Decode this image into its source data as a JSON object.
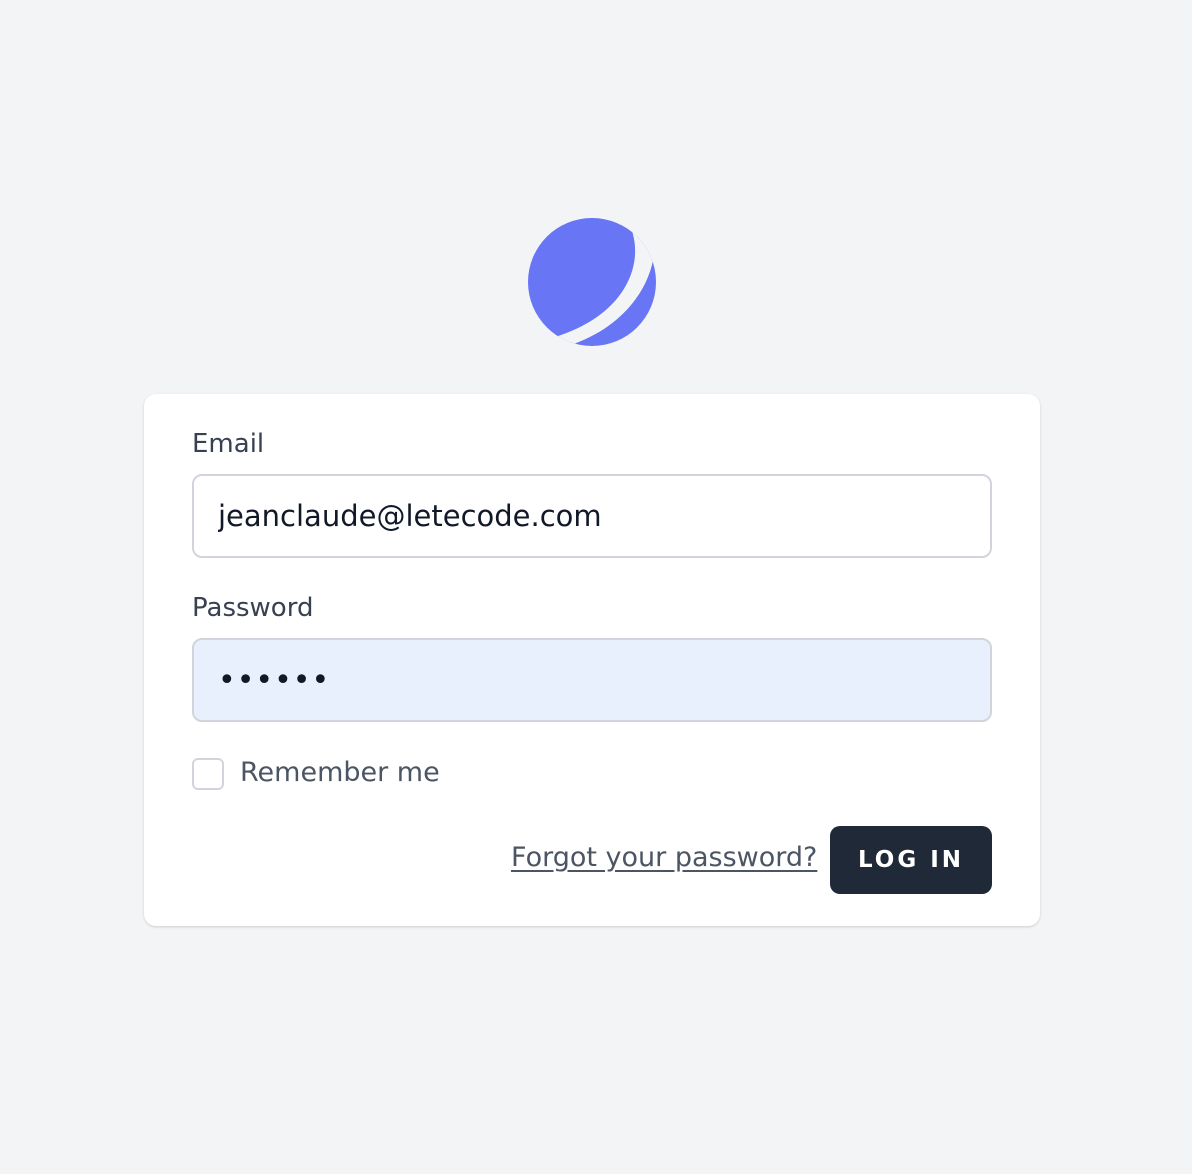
{
  "colors": {
    "background": "#f3f4f6",
    "logo": "#6875f5",
    "button": "#1f2937",
    "autofill": "#e8f0fe"
  },
  "logo": {
    "icon": "crescent-planet-logo"
  },
  "form": {
    "email_label": "Email",
    "email_value": "jeanclaude@letecode.com",
    "password_label": "Password",
    "password_display": "••••••",
    "remember_label": "Remember me",
    "remember_checked": false,
    "forgot_link": "Forgot your password?",
    "login_button": "LOG IN"
  }
}
